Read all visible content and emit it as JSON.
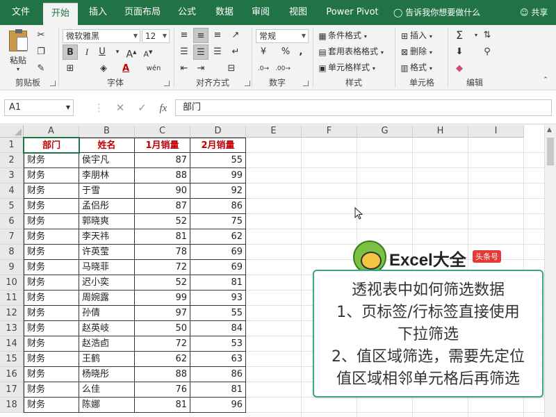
{
  "tabs": [
    {
      "label": "文件",
      "left": 0
    },
    {
      "label": "开始",
      "left": 0
    },
    {
      "label": "插入",
      "left": 0
    },
    {
      "label": "页面布局",
      "left": 0
    },
    {
      "label": "公式",
      "left": 0
    },
    {
      "label": "数据",
      "left": 0
    },
    {
      "label": "审阅",
      "left": 0
    },
    {
      "label": "视图",
      "left": 0
    },
    {
      "label": "Power Pivot",
      "left": 0
    }
  ],
  "tell_me": "告诉我你想要做什么",
  "share": "共享",
  "ribbon": {
    "clipboard": {
      "paste": "粘贴",
      "label": "剪贴板"
    },
    "font": {
      "name": "微软雅黑",
      "size": "12",
      "bold": "B",
      "italic": "I",
      "underline": "U",
      "label": "字体"
    },
    "alignment": {
      "label": "对齐方式"
    },
    "number": {
      "format": "常规",
      "label": "数字"
    },
    "styles": {
      "conditional": "条件格式",
      "table": "套用表格格式",
      "cell": "单元格样式",
      "label": "样式"
    },
    "cells": {
      "insert": "插入",
      "delete": "删除",
      "format": "格式",
      "label": "单元格"
    },
    "editing": {
      "label": "编辑"
    }
  },
  "formula_bar": {
    "name_box": "A1",
    "content": "部门"
  },
  "columns": [
    "A",
    "B",
    "C",
    "D",
    "E",
    "F",
    "G",
    "H",
    "I"
  ],
  "headers": [
    "部门",
    "姓名",
    "1月销量",
    "2月销量"
  ],
  "rows": [
    [
      "财务",
      "侯宇凡",
      "87",
      "55"
    ],
    [
      "财务",
      "李朋林",
      "88",
      "99"
    ],
    [
      "财务",
      "于雪",
      "90",
      "92"
    ],
    [
      "财务",
      "孟侣彤",
      "87",
      "86"
    ],
    [
      "财务",
      "郭晓爽",
      "52",
      "75"
    ],
    [
      "财务",
      "李天祎",
      "81",
      "62"
    ],
    [
      "财务",
      "许英莹",
      "78",
      "69"
    ],
    [
      "财务",
      "马晓菲",
      "72",
      "69"
    ],
    [
      "财务",
      "迟小奕",
      "52",
      "81"
    ],
    [
      "财务",
      "周婉露",
      "99",
      "93"
    ],
    [
      "财务",
      "孙倩",
      "97",
      "55"
    ],
    [
      "财务",
      "赵英岐",
      "50",
      "84"
    ],
    [
      "财务",
      "赵浩卣",
      "72",
      "53"
    ],
    [
      "财务",
      "王鹤",
      "62",
      "63"
    ],
    [
      "财务",
      "杨晓彤",
      "88",
      "86"
    ],
    [
      "财务",
      "么佳",
      "76",
      "81"
    ],
    [
      "财务",
      "陈娜",
      "81",
      "96"
    ]
  ],
  "row_numbers": [
    "1",
    "2",
    "3",
    "4",
    "5",
    "6",
    "7",
    "8",
    "9",
    "10",
    "11",
    "12",
    "13",
    "14",
    "15",
    "16",
    "17",
    "18"
  ],
  "logo": {
    "text": "Excel大全",
    "tag": "头条号"
  },
  "info": {
    "line1": "透视表中如何筛选数据",
    "line2": "1、页标签/行标签直接使用",
    "line3": "下拉筛选",
    "line4": "2、值区域筛选，需要先定位",
    "line5": "值区域相邻单元格后再筛选"
  },
  "colors": {
    "excel_green": "#217346",
    "header_red": "#c00000",
    "info_border": "#3aa58f"
  }
}
